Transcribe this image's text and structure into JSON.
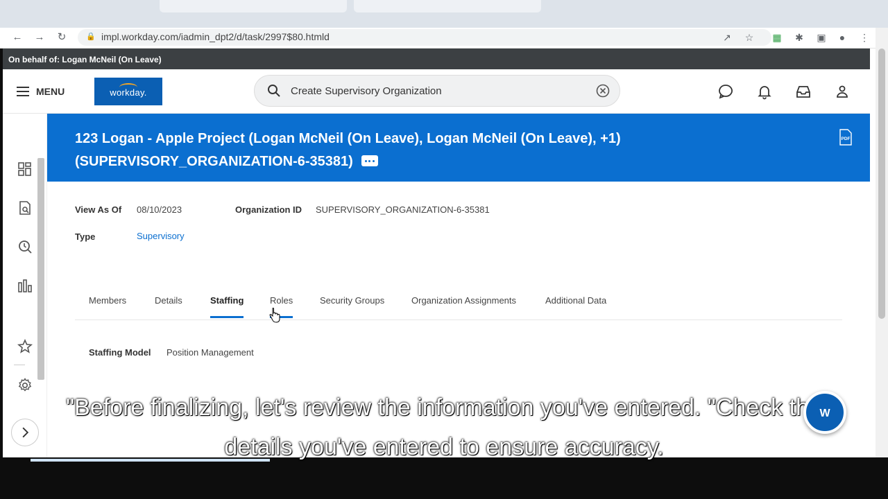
{
  "browser": {
    "url": "impl.workday.com/iadmin_dpt2/d/task/2997$80.htmld"
  },
  "proxy_banner": "On behalf of: Logan McNeil (On Leave)",
  "header": {
    "menu_label": "MENU",
    "logo_text": "workday.",
    "search_value": "Create Supervisory Organization"
  },
  "title_banner": {
    "title": "123 Logan - Apple Project (Logan McNeil (On Leave), Logan McNeil (On Leave), +1) (SUPERVISORY_ORGANIZATION-6-35381)",
    "pdf_label": "PDF"
  },
  "fields": {
    "view_as_of_label": "View As Of",
    "view_as_of_value": "08/10/2023",
    "org_id_label": "Organization ID",
    "org_id_value": "SUPERVISORY_ORGANIZATION-6-35381",
    "type_label": "Type",
    "type_value": "Supervisory"
  },
  "tabs": [
    {
      "label": "Members"
    },
    {
      "label": "Details"
    },
    {
      "label": "Staffing"
    },
    {
      "label": "Roles"
    },
    {
      "label": "Security Groups"
    },
    {
      "label": "Organization Assignments"
    },
    {
      "label": "Additional Data"
    }
  ],
  "active_tab": "Staffing",
  "staffing": {
    "model_label": "Staffing Model",
    "model_value": "Position Management"
  },
  "caption": {
    "line1": "\"Before finalizing, let's review the information you've entered. \"Check the",
    "line2": "details you've entered to ensure accuracy."
  },
  "assistant_label": "W",
  "colors": {
    "brand_blue": "#0b6fd0",
    "logo_blue": "#0b5fb3",
    "proxy_banner_bg": "#3c4043"
  }
}
